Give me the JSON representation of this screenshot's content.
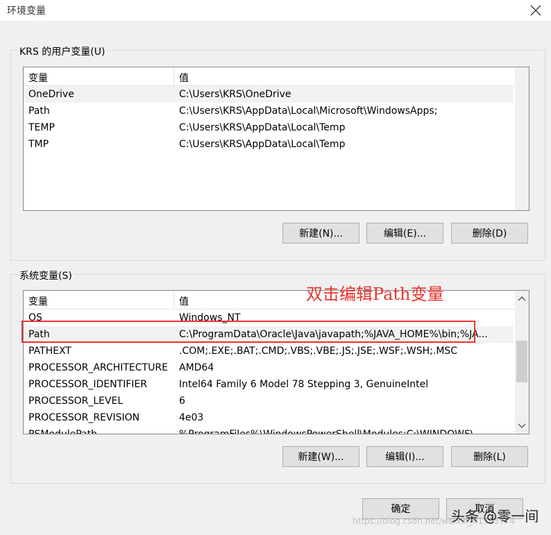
{
  "window": {
    "title": "环境变量"
  },
  "user_vars": {
    "group_label": "KRS 的用户变量(U)",
    "columns": [
      "变量",
      "值"
    ],
    "rows": [
      {
        "name": "OneDrive",
        "value": "C:\\Users\\KRS\\OneDrive"
      },
      {
        "name": "Path",
        "value": "C:\\Users\\KRS\\AppData\\Local\\Microsoft\\WindowsApps;"
      },
      {
        "name": "TEMP",
        "value": "C:\\Users\\KRS\\AppData\\Local\\Temp"
      },
      {
        "name": "TMP",
        "value": "C:\\Users\\KRS\\AppData\\Local\\Temp"
      }
    ],
    "buttons": {
      "new": "新建(N)...",
      "edit": "编辑(E)...",
      "delete": "删除(D)"
    }
  },
  "system_vars": {
    "group_label": "系统变量(S)",
    "columns": [
      "变量",
      "值"
    ],
    "rows": [
      {
        "name": "OS",
        "value": "Windows_NT"
      },
      {
        "name": "Path",
        "value": "C:\\ProgramData\\Oracle\\Java\\javapath;%JAVA_HOME%\\bin;%JA..."
      },
      {
        "name": "PATHEXT",
        "value": ".COM;.EXE;.BAT;.CMD;.VBS;.VBE;.JS;.JSE;.WSF;.WSH;.MSC"
      },
      {
        "name": "PROCESSOR_ARCHITECTURE",
        "value": "AMD64"
      },
      {
        "name": "PROCESSOR_IDENTIFIER",
        "value": "Intel64 Family 6 Model 78 Stepping 3, GenuineIntel"
      },
      {
        "name": "PROCESSOR_LEVEL",
        "value": "6"
      },
      {
        "name": "PROCESSOR_REVISION",
        "value": "4e03"
      },
      {
        "name": "PSModulePath",
        "value": "%ProgramFiles%\\WindowsPowerShell\\Modules;C:\\WINDOWS\\..."
      }
    ],
    "buttons": {
      "new": "新建(W)...",
      "edit": "编辑(I)...",
      "delete": "删除(L)"
    }
  },
  "dialog_buttons": {
    "ok": "确定",
    "cancel": "取消"
  },
  "annotation": {
    "text": "双击编辑Path变量",
    "color": "#e8342c"
  },
  "watermark": {
    "text": "https://blog.csdn.net/weixin_41385774"
  },
  "brand": {
    "text": "头条 @零一间"
  }
}
